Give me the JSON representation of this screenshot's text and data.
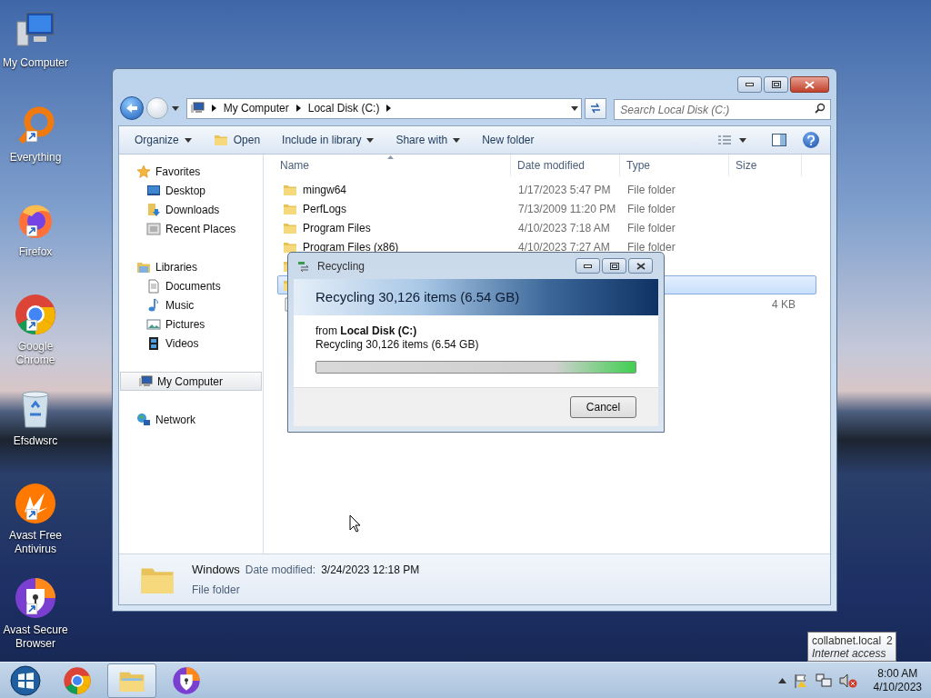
{
  "desktop_icons": [
    {
      "label": "My Computer",
      "kind": "computer",
      "shortcut": false
    },
    {
      "label": "Everything",
      "kind": "magnifier",
      "shortcut": true
    },
    {
      "label": "Firefox",
      "kind": "firefox",
      "shortcut": true
    },
    {
      "label": "Google Chrome",
      "kind": "chrome",
      "shortcut": true
    },
    {
      "label": "Efsdwsrc",
      "kind": "bin",
      "shortcut": false
    },
    {
      "label": "Avast Free Antivirus",
      "kind": "avast",
      "shortcut": true
    },
    {
      "label": "Avast Secure Browser",
      "kind": "avast-browser",
      "shortcut": true
    }
  ],
  "explorer": {
    "breadcrumb": [
      "My Computer",
      "Local Disk (C:)"
    ],
    "search": {
      "placeholder": "Search Local Disk (C:)"
    },
    "toolbar": [
      {
        "label": "Organize",
        "kind": "plain",
        "dropdown": true
      },
      {
        "label": "Open",
        "kind": "folder",
        "dropdown": false
      },
      {
        "label": "Include in library",
        "kind": "plain",
        "dropdown": true
      },
      {
        "label": "Share with",
        "kind": "plain",
        "dropdown": true
      },
      {
        "label": "New folder",
        "kind": "plain",
        "dropdown": false
      }
    ],
    "nav": [
      {
        "label": "Favorites",
        "kind": "star",
        "selected": false,
        "children": [
          {
            "label": "Desktop",
            "kind": "desktop",
            "selected": false
          },
          {
            "label": "Downloads",
            "kind": "downloads",
            "selected": false
          },
          {
            "label": "Recent Places",
            "kind": "recent",
            "selected": false
          }
        ]
      },
      {
        "label": "Libraries",
        "kind": "libraries",
        "selected": false,
        "children": [
          {
            "label": "Documents",
            "kind": "document",
            "selected": false
          },
          {
            "label": "Music",
            "kind": "music",
            "selected": false
          },
          {
            "label": "Pictures",
            "kind": "picture",
            "selected": false
          },
          {
            "label": "Videos",
            "kind": "video",
            "selected": false
          }
        ]
      },
      {
        "label": "My Computer",
        "kind": "computer",
        "selected": true
      },
      {
        "label": "Network",
        "kind": "network",
        "selected": false
      }
    ],
    "columns": [
      {
        "label": "Name",
        "sorted": true
      },
      {
        "label": "Date modified",
        "sorted": false
      },
      {
        "label": "Type",
        "sorted": false
      },
      {
        "label": "Size",
        "sorted": false
      }
    ],
    "rows": [
      {
        "kind": "folder",
        "name": "mingw64",
        "date": "1/17/2023 5:47 PM",
        "type": "File folder",
        "selected": false
      },
      {
        "kind": "folder",
        "name": "PerfLogs",
        "date": "7/13/2009 11:20 PM",
        "type": "File folder",
        "selected": false
      },
      {
        "kind": "folder",
        "name": "Program Files",
        "date": "4/10/2023 7:18 AM",
        "type": "File folder",
        "selected": false
      },
      {
        "kind": "folder",
        "name": "Program Files (x86)",
        "date": "4/10/2023 7:27 AM",
        "type": "File folder",
        "selected": false
      },
      {
        "kind": "folder",
        "selected": false
      },
      {
        "kind": "folder",
        "selected": true
      },
      {
        "kind": "file",
        "size": "4 KB",
        "selected": false
      }
    ],
    "details": {
      "name": "Windows",
      "date_label": "Date modified:",
      "date": "3/24/2023 12:18 PM",
      "type": "File folder"
    }
  },
  "dialog": {
    "title": "Recycling",
    "heading": "Recycling 30,126 items (6.54 GB)",
    "source": "from **Local Disk (C:)**",
    "status": "Recycling 30,126 items (6.54 GB)",
    "progress": {
      "level": 1
    },
    "button": "Cancel"
  },
  "taskbar": {
    "apps": [
      {
        "kind": "chrome",
        "selected": false
      },
      {
        "kind": "explorer",
        "selected": true
      },
      {
        "kind": "avast-browser",
        "selected": false
      }
    ],
    "time": "8:00 AM",
    "date": "4/10/2023",
    "tooltip": {
      "title": "collabnet.local",
      "count": "2",
      "subtitle": "Internet access"
    }
  }
}
